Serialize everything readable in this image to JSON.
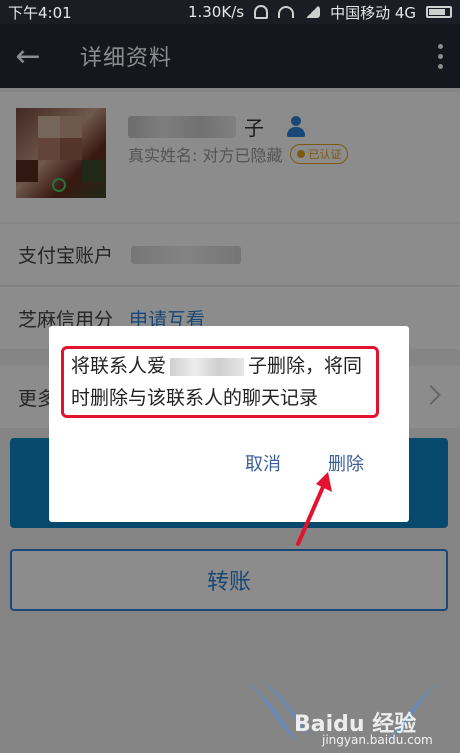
{
  "status_bar": {
    "time": "下午4:01",
    "network_speed": "1.30K/s",
    "carrier": "中国移动 4G"
  },
  "app_bar": {
    "title": "详细资料"
  },
  "profile": {
    "name_tail": "子",
    "real_name": "真实姓名: 对方已隐藏",
    "verified_badge": "已认证"
  },
  "rows": {
    "account_label": "支付宝账户",
    "zhima_label": "芝麻信用分",
    "zhima_link": "申请互看",
    "more_label": "更多"
  },
  "buttons": {
    "transfer": "转账"
  },
  "dialog": {
    "message_part1": "将联系人爱",
    "message_part2": "子删除，将同时删除与该联系人的聊天记录",
    "cancel": "取消",
    "delete": "删除"
  },
  "watermark": {
    "brand": "Baidu 经验",
    "url": "jingyan.baidu.com"
  }
}
